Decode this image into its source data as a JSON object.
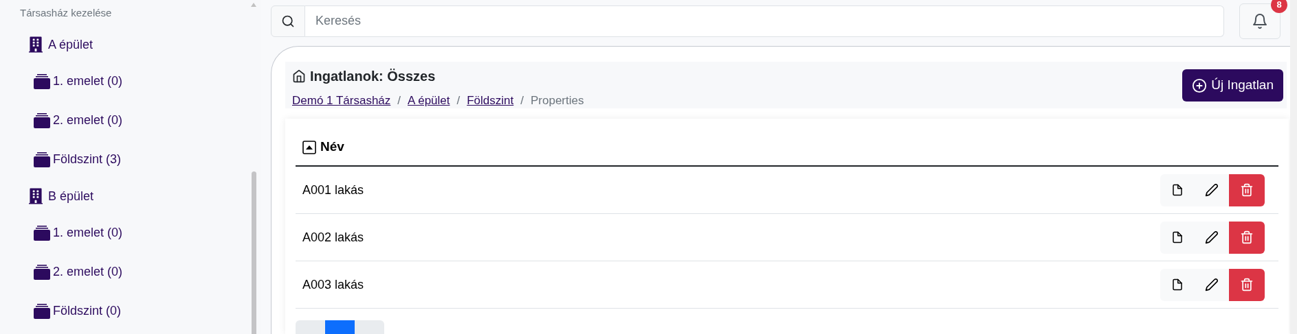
{
  "sidebar": {
    "title": "Társasház kezelése",
    "tree": [
      {
        "label": "A épület",
        "children": [
          {
            "label": "1. emelet (0)"
          },
          {
            "label": "2. emelet (0)"
          },
          {
            "label": "Földszint (3)"
          }
        ]
      },
      {
        "label": "B épület",
        "children": [
          {
            "label": "1. emelet (0)"
          },
          {
            "label": "2. emelet (0)"
          },
          {
            "label": "Földszint (0)"
          }
        ]
      }
    ]
  },
  "search": {
    "placeholder": "Keresés"
  },
  "notifications": {
    "count": "8"
  },
  "page": {
    "title": "Ingatlanok: Összes",
    "separator": "/",
    "breadcrumb": [
      {
        "label": "Demó 1 Társasház",
        "link": true
      },
      {
        "label": "A épület",
        "link": true
      },
      {
        "label": "Földszint",
        "link": true
      },
      {
        "label": "Properties",
        "link": false
      }
    ],
    "new_button": "Új Ingatlan"
  },
  "table": {
    "column": "Név",
    "rows": [
      {
        "name": "A001 lakás"
      },
      {
        "name": "A002 lakás"
      },
      {
        "name": "A003 lakás"
      }
    ]
  },
  "pagination": [
    {
      "selected": false
    },
    {
      "selected": true
    },
    {
      "selected": false
    }
  ]
}
